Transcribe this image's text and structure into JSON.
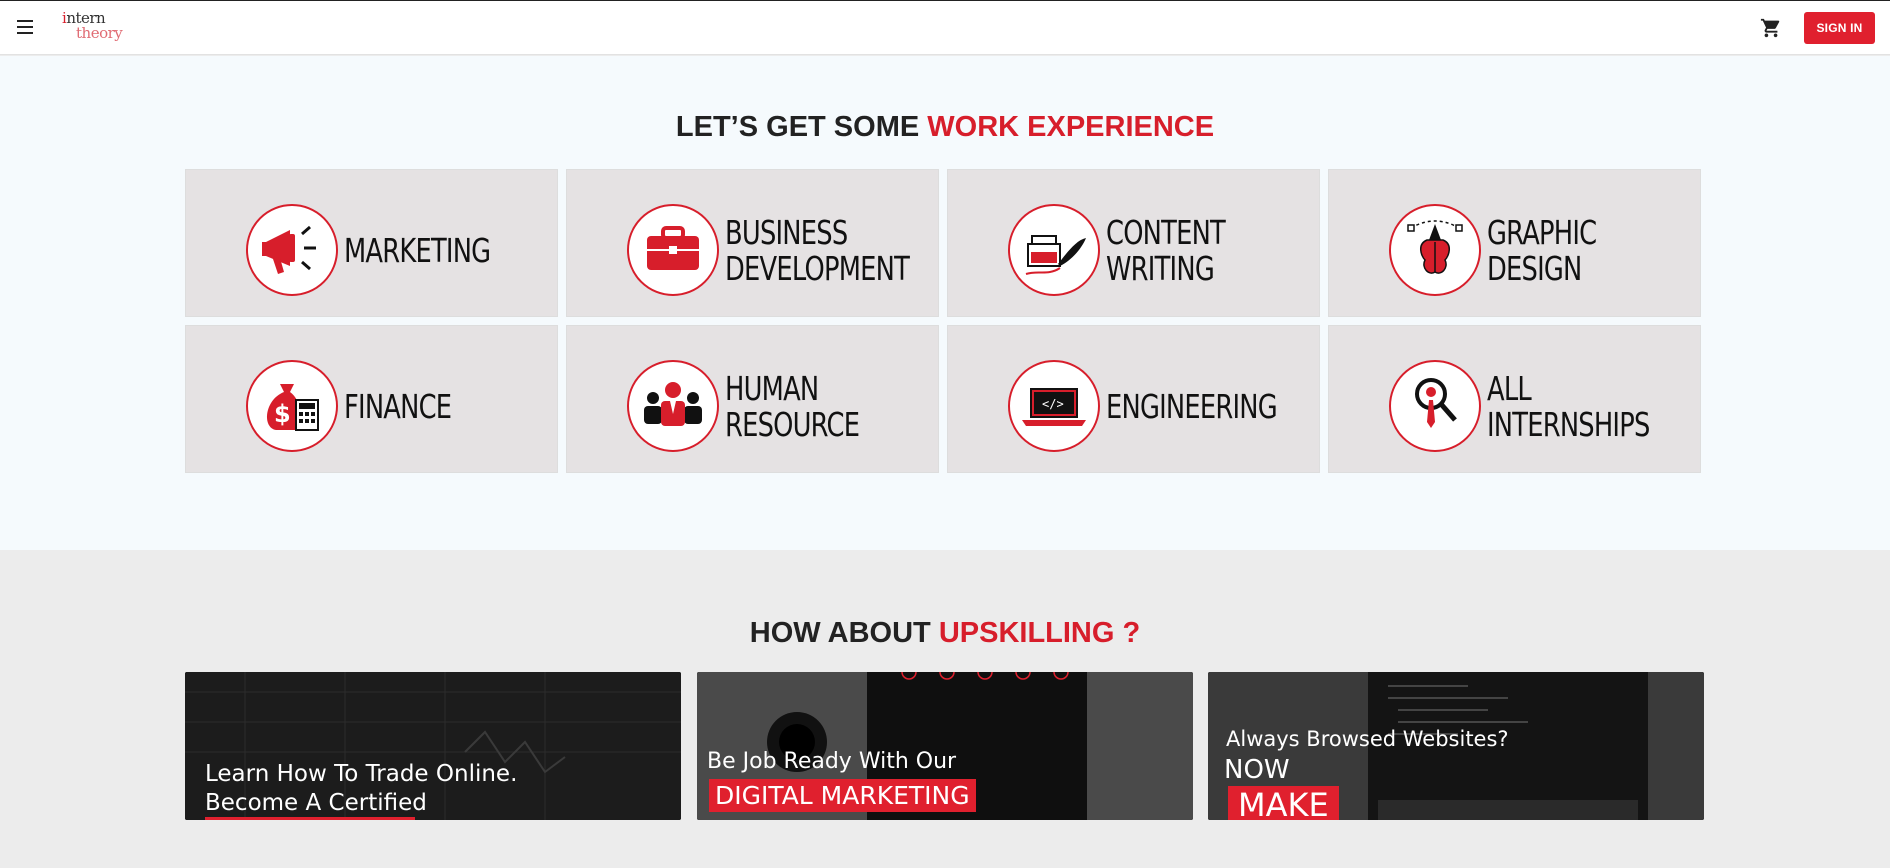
{
  "header": {
    "logo_line1_i": "i",
    "logo_line1_rest": "ntern",
    "logo_line2": "theory",
    "signin_label": "SIGN IN",
    "icons": [
      "menu-icon",
      "cart-icon"
    ]
  },
  "work_experience": {
    "title_main": "LET’S GET SOME ",
    "title_highlight": "WORK EXPERIENCE",
    "categories": [
      {
        "line1": "MARKETING",
        "line2": "",
        "icon": "megaphone-icon"
      },
      {
        "line1": "BUSINESS",
        "line2": "DEVELOPMENT",
        "icon": "briefcase-icon"
      },
      {
        "line1": "CONTENT",
        "line2": "WRITING",
        "icon": "ink-quill-icon"
      },
      {
        "line1": "GRAPHIC",
        "line2": "DESIGN",
        "icon": "pen-tool-brain-icon"
      },
      {
        "line1": "FINANCE",
        "line2": "",
        "icon": "money-calculator-icon"
      },
      {
        "line1": "HUMAN",
        "line2": "RESOURCE",
        "icon": "people-icon"
      },
      {
        "line1": "ENGINEERING",
        "line2": "",
        "icon": "laptop-code-icon"
      },
      {
        "line1": "ALL",
        "line2": "INTERNSHIPS",
        "icon": "magnifier-person-icon"
      }
    ]
  },
  "upskilling": {
    "title_main": "HOW ABOUT ",
    "title_highlight": "UPSKILLING ?",
    "cards": [
      {
        "line1": "Learn How To Trade Online.",
        "line2": "Become A Certified"
      },
      {
        "line1": "Be Job Ready With Our",
        "band": "DIGITAL MARKETING"
      },
      {
        "line1": "Always Browsed Websites?",
        "line2": "NOW",
        "band": "MAKE"
      }
    ]
  },
  "colors": {
    "accent": "#d71e2b",
    "tile_bg": "#e5e2e3",
    "section_bg": "#f5fafd"
  }
}
